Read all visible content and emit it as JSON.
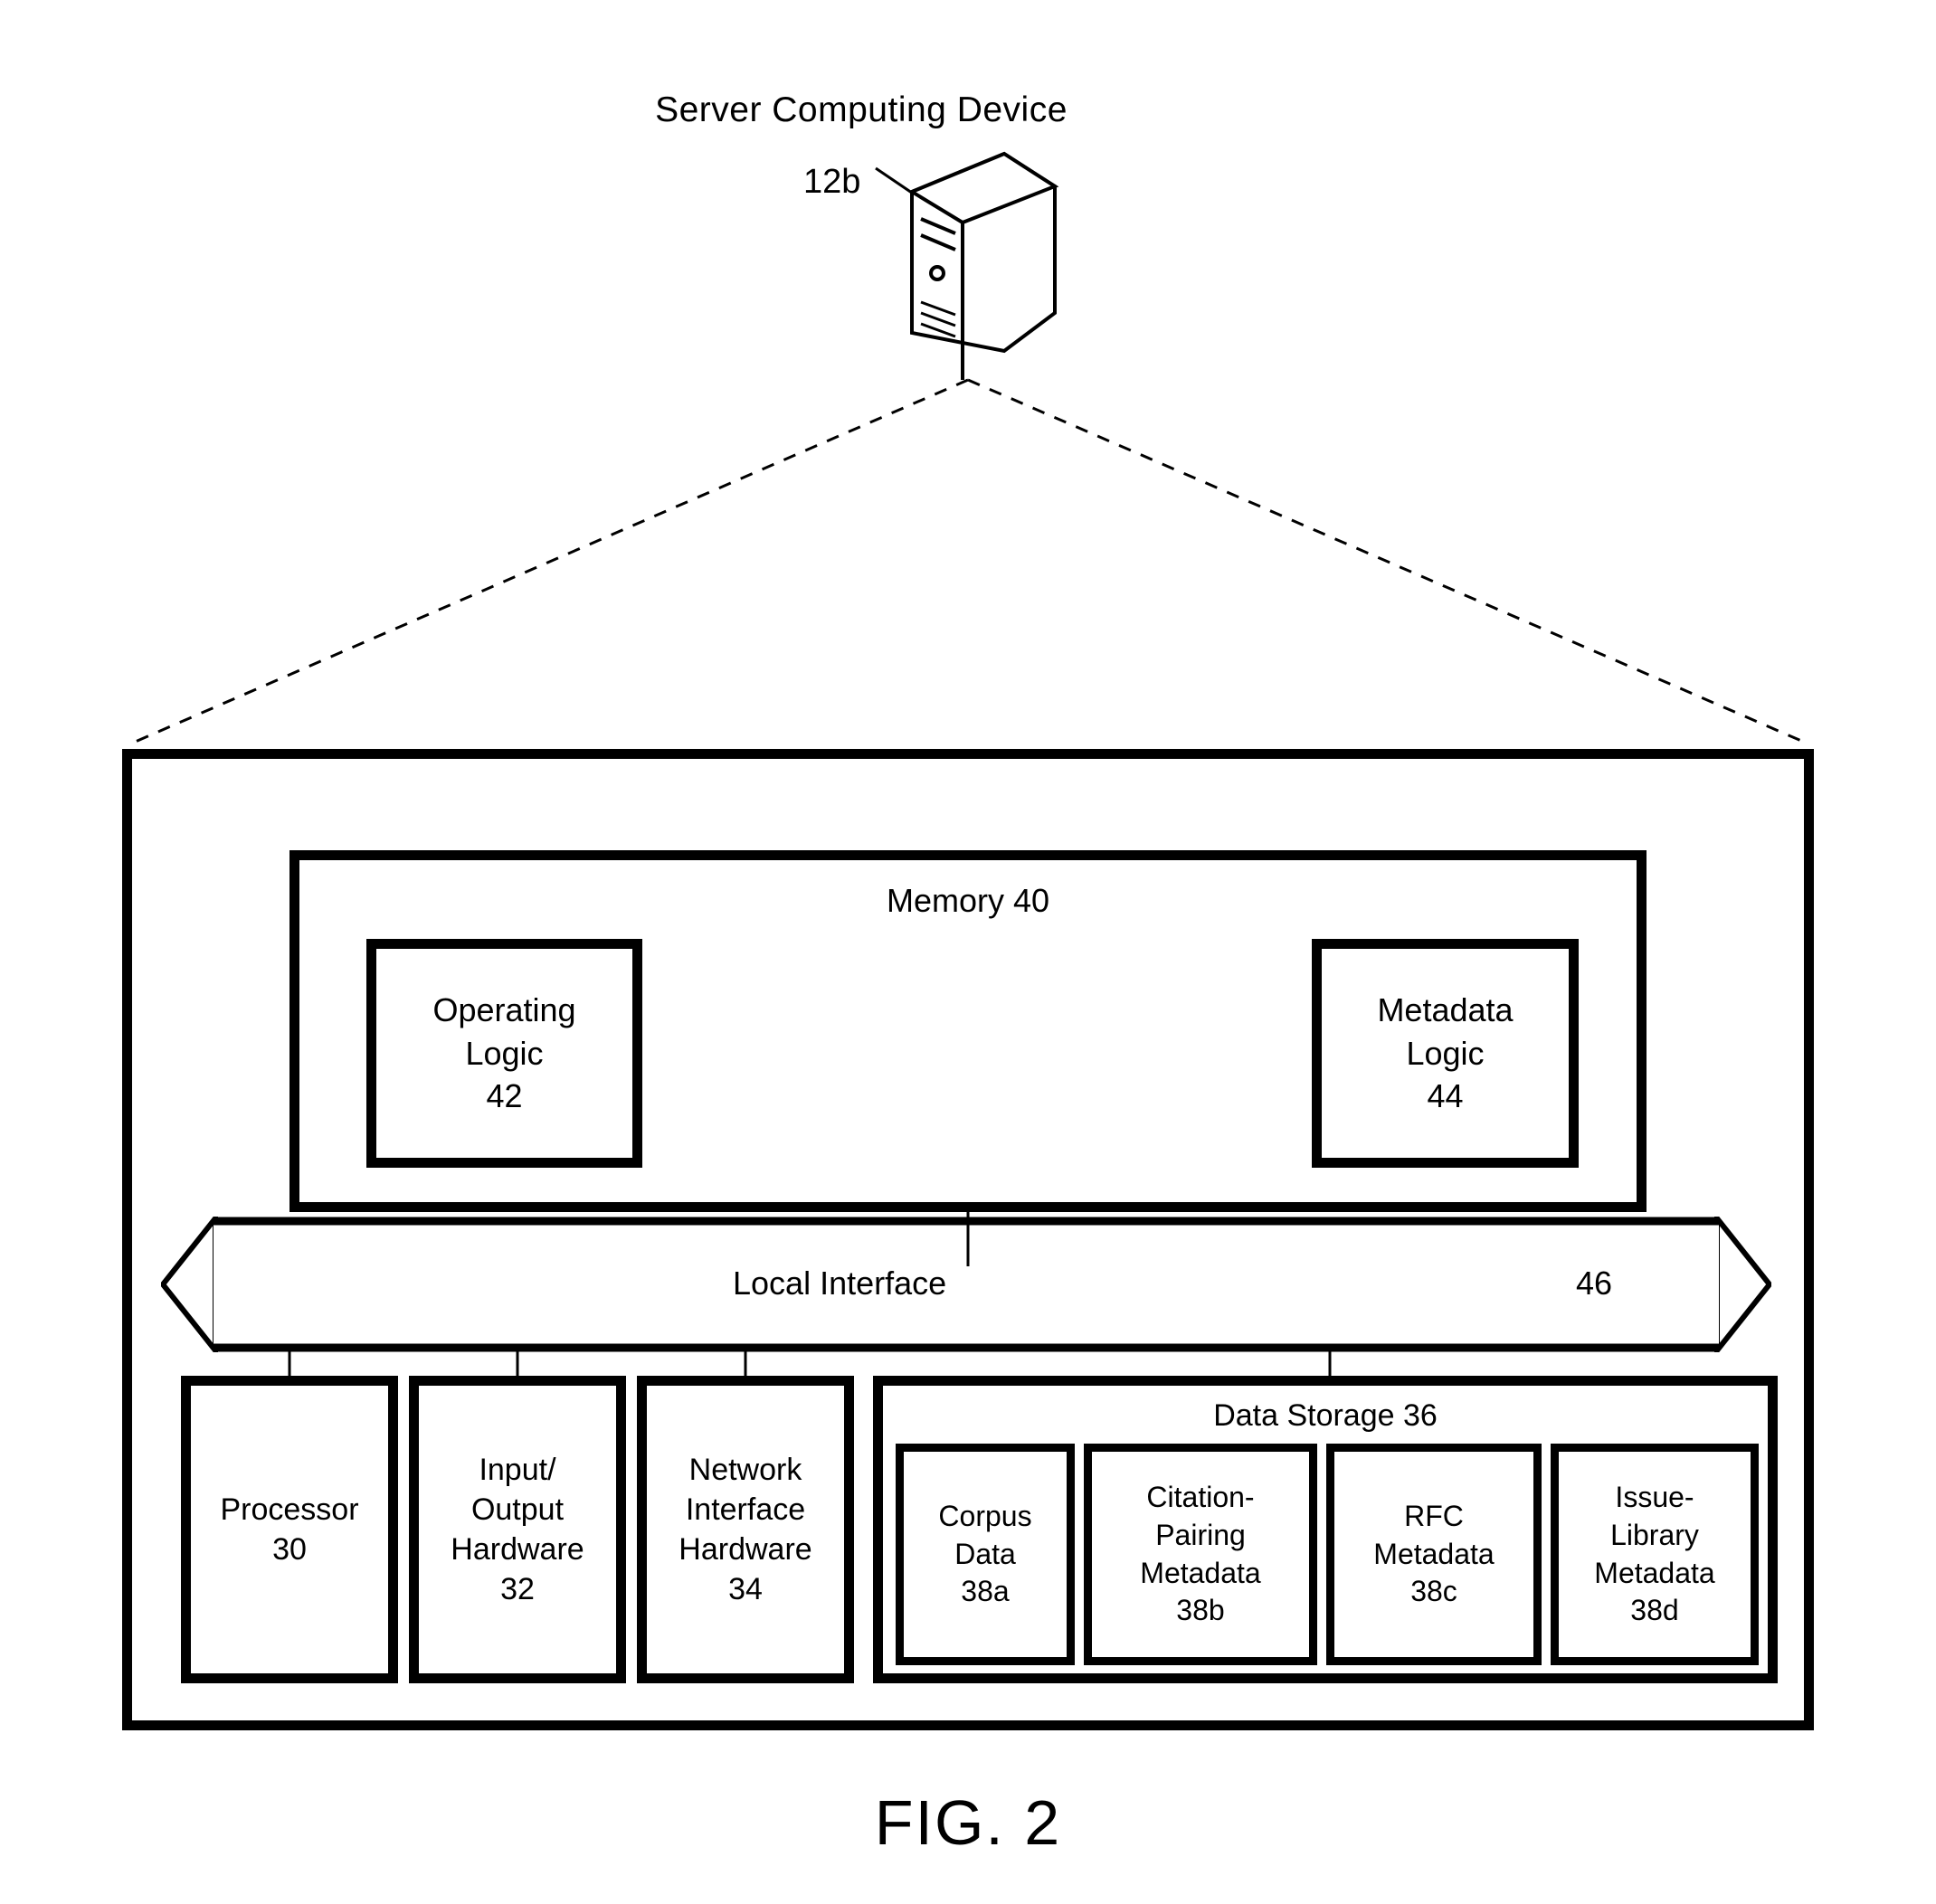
{
  "figure": {
    "caption": "FIG. 2",
    "title": "Server Computing Device",
    "device_ref": "12b"
  },
  "memory": {
    "title": "Memory 40",
    "blocks": [
      {
        "name": "operating-logic",
        "lines": [
          "Operating",
          "Logic",
          "42"
        ]
      },
      {
        "name": "metadata-logic",
        "lines": [
          "Metadata",
          "Logic",
          "44"
        ]
      }
    ]
  },
  "bus": {
    "label": "Local Interface",
    "ref": "46"
  },
  "components": [
    {
      "name": "processor",
      "lines": [
        "Processor",
        "30"
      ]
    },
    {
      "name": "input-output-hardware",
      "lines": [
        "Input/",
        "Output",
        "Hardware",
        "32"
      ]
    },
    {
      "name": "network-interface-hardware",
      "lines": [
        "Network",
        "Interface",
        "Hardware",
        "34"
      ]
    }
  ],
  "data_storage": {
    "title": "Data Storage 36",
    "stores": [
      {
        "name": "corpus-data",
        "lines": [
          "Corpus",
          "Data",
          "38a"
        ]
      },
      {
        "name": "citation-pairing-metadata",
        "lines": [
          "Citation-",
          "Pairing",
          "Metadata",
          "38b"
        ]
      },
      {
        "name": "rfc-metadata",
        "lines": [
          "RFC",
          "Metadata",
          "38c"
        ]
      },
      {
        "name": "issue-library-metadata",
        "lines": [
          "Issue-",
          "Library",
          "Metadata",
          "38d"
        ]
      }
    ]
  },
  "colors": {
    "stroke": "#000000",
    "background": "#ffffff"
  }
}
